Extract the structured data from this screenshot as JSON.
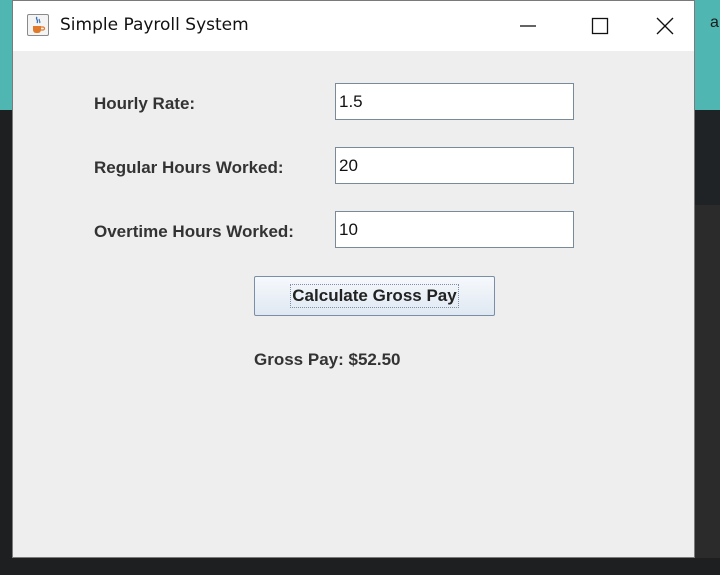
{
  "background": {
    "peek_char": "a"
  },
  "window": {
    "title": "Simple Payroll System",
    "icon": "java-cup-icon",
    "controls": {
      "minimize_icon": "minimize-icon",
      "maximize_icon": "maximize-icon",
      "close_icon": "close-icon"
    }
  },
  "form": {
    "hourly_rate": {
      "label": "Hourly Rate:",
      "value": "1.5"
    },
    "regular_hours": {
      "label": "Regular Hours Worked:",
      "value": "20"
    },
    "overtime_hours": {
      "label": "Overtime Hours Worked:",
      "value": "10"
    },
    "calculate_button": "Calculate Gross Pay",
    "result": "Gross Pay: $52.50"
  },
  "colors": {
    "window_bg": "#eeeeee",
    "titlebar_bg": "#ffffff",
    "desktop_teal": "#4fb6b2"
  }
}
